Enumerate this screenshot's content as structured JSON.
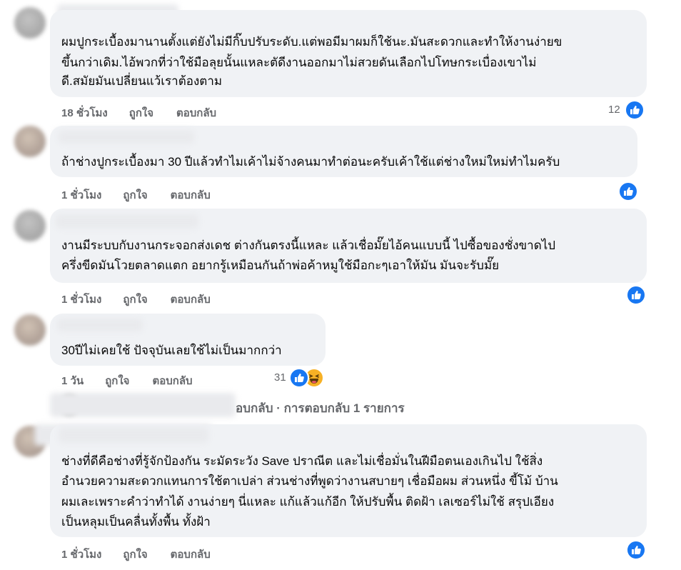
{
  "comments": [
    {
      "lines": [
        "ผมปูกระเบื้องมานานตั้งแต่ยังไม่มีกิ๊บปรับระดับ.แต่พอมีมาผมก็ใช้นะ.มันสะดวกและทำให้งานง่ายข",
        "ขึ้นกว่าเดิม.ไอ้พวกที่ว่าใช้มือลุยนั้นแหละตัดีงานออกมาไม่สวยดันเลือกไปโทษกระเบื่องเขาไม่",
        "ดี.สมัยมันเปลี่ยนแว้เราต้องตาม"
      ],
      "time": "18 ชั่วโมง",
      "like": "ถูกใจ",
      "reply": "ตอบกลับ",
      "reactions": "12"
    },
    {
      "lines": [
        "ถ้าช่างปูกระเบื้องมา 30 ปีแล้วทำไมเค้าไม่จ้างคนมาทำต่อนะครับเค้าใช้แต่ช่างใหม่ใหม่ทำไมครับ"
      ],
      "time": "1 ชั่วโมง",
      "like": "ถูกใจ",
      "reply": "ตอบกลับ",
      "reactions": ""
    },
    {
      "lines": [
        "งานมีระบบกับงานกระจอกส่งเดช ต่างกันตรงนี้แหละ แล้วเชื่อมั๊ยไอ้คนแบบนี้ ไปซื้อของชั่งขาดไป",
        "ครึ่งขีดมันโวยตลาดแตก อยากรู้เหมือนกันถ้าพ่อค้าหมูใช้มือกะๆเอาให้มัน มันจะรับมั๊ย"
      ],
      "time": "1 ชั่วโมง",
      "like": "ถูกใจ",
      "reply": "ตอบกลับ",
      "reactions": ""
    },
    {
      "lines": [
        "30ปีไม่เคยใช้ ปัจจุบันเลยใช้ไม่เป็นมากกว่า"
      ],
      "time": "1 วัน",
      "like": "ถูกใจ",
      "reply": "ตอบกลับ",
      "reactions": "31"
    },
    {
      "lines": [
        "ช่างที่ดีคือช่างที่รู้จักป้องกัน ระมัดระวัง Save ปราณีต และไม่เชื่อมั่นในฝีมือตนเองเกินไป ใช้สิ่ง",
        "อำนวยความสะดวกแทนการใช้ตาเปล่า ส่วนช่างที่พูดว่างานสบายๆ เชื่อมือผม ส่วนหนึ่ง ขี้โม้ บ้าน",
        "ผมเละเพราะคำว่าทำได้ งานง่ายๆ นี่แหละ แก้แล้วแก้อีก ให้ปรับพื้น ติดฝ้า เลเซอร์ไม่ใช้ สรุปเอียง",
        "เป็นหลุมเป็นคลื่นทั้งพื้น ทั้งฝ้า"
      ],
      "time": "1 ชั่วโมง",
      "like": "ถูกใจ",
      "reply": "ตอบกลับ",
      "reactions": ""
    }
  ],
  "reply_summary": "อบกลับ · การตอบกลับ 1 รายการ",
  "colors": {
    "like_blue": "#1877f2",
    "bubble": "#f0f2f5",
    "muted": "#65676b"
  },
  "icons": {
    "like": "thumbs-up-icon",
    "haha": "haha-emoji-icon"
  }
}
